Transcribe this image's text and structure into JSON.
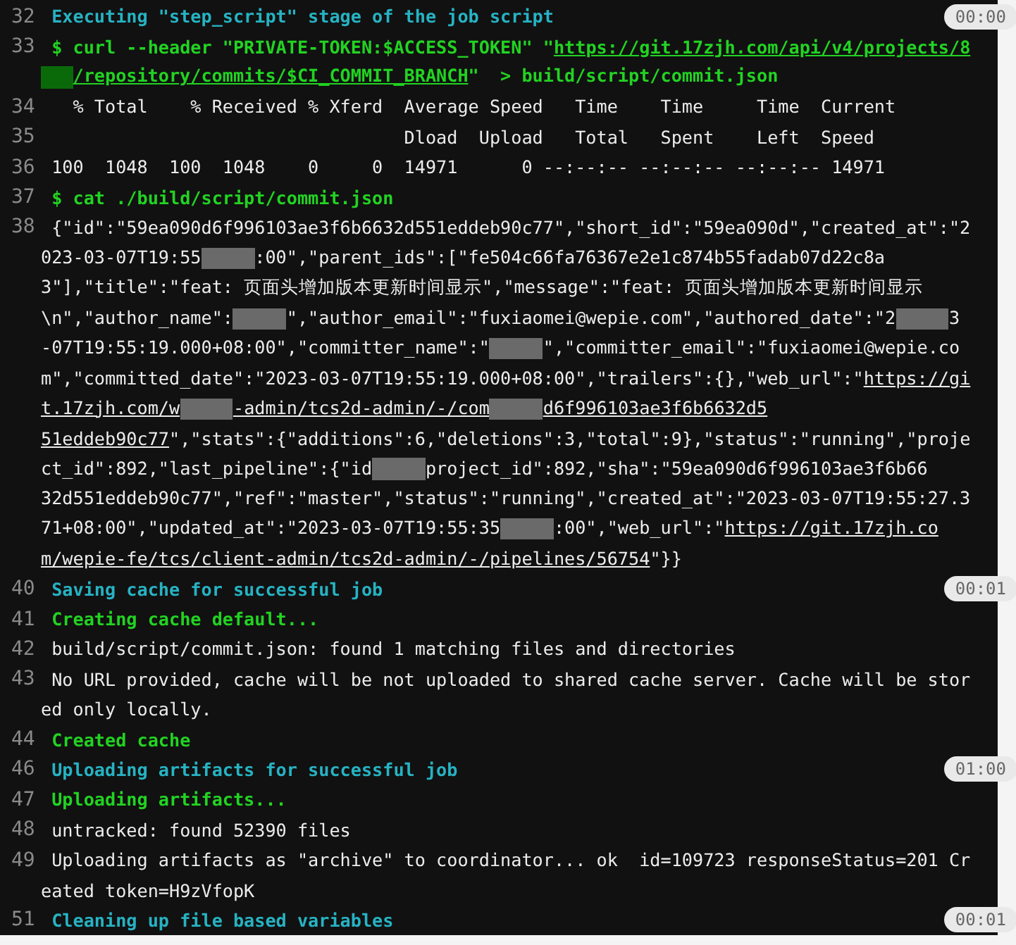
{
  "log": {
    "lines": [
      {
        "number": "32",
        "kind": "section",
        "segments": [
          {
            "kind": "text",
            "text": " Executing \"step_script\" stage of the job script"
          }
        ],
        "time": "00:00"
      },
      {
        "number": "33",
        "kind": "command",
        "segments": [
          {
            "kind": "text",
            "text": " $ curl --header \"PRIVATE-TOKEN:$ACCESS_TOKEN\" \""
          },
          {
            "kind": "link",
            "text": "https://git.17zjh.com/api/v4/projects/8"
          }
        ]
      },
      {
        "kind": "command",
        "segments": [
          {
            "kind": "redacted"
          },
          {
            "kind": "link",
            "text": "/repository/commits/$CI_COMMIT_BRANCH"
          },
          {
            "kind": "text",
            "text": "\"  > build/script/commit.json"
          }
        ]
      },
      {
        "number": "34",
        "kind": "plain",
        "segments": [
          {
            "kind": "text",
            "text": "   % Total    % Received % Xferd  Average Speed   Time    Time     Time  Current"
          }
        ]
      },
      {
        "number": "35",
        "kind": "plain",
        "segments": [
          {
            "kind": "text",
            "text": "                                  Dload  Upload   Total   Spent    Left  Speed"
          }
        ]
      },
      {
        "number": "36",
        "kind": "plain",
        "segments": [
          {
            "kind": "text",
            "text": " 100  1048  100  1048    0     0  14971      0 --:--:-- --:--:-- --:--:-- 14971"
          }
        ]
      },
      {
        "number": "37",
        "kind": "command",
        "segments": [
          {
            "kind": "text",
            "text": " $ cat ./build/script/commit.json"
          }
        ]
      },
      {
        "number": "38",
        "kind": "plain",
        "segments": [
          {
            "kind": "text",
            "text": " {\"id\":\"59ea090d6f996103ae3f6b6632d551eddeb90c77\",\"short_id\":\"59ea090d\",\"created_at\":\"2"
          }
        ]
      },
      {
        "kind": "plain",
        "segments": [
          {
            "kind": "text",
            "text": "023-03-07T19:55"
          },
          {
            "kind": "redacted"
          },
          {
            "kind": "text",
            "text": ":00\",\"parent_ids\":[\"fe504c66fa76367e2e1c874b55fadab07d22c8a"
          }
        ]
      },
      {
        "kind": "plain",
        "segments": [
          {
            "kind": "text",
            "text": "3\"],\"title\":\"feat: 页面头增加版本更新时间显示\",\"message\":\"feat: 页面头增加版本更新时间显示"
          }
        ]
      },
      {
        "kind": "plain",
        "segments": [
          {
            "kind": "text",
            "text": "\\n\",\"author_name\":"
          },
          {
            "kind": "redacted"
          },
          {
            "kind": "text",
            "text": "\",\"author_email\":\"fuxiaomei@wepie.com\",\"authored_date\":\"2"
          },
          {
            "kind": "redacted"
          },
          {
            "kind": "text",
            "text": "3"
          }
        ]
      },
      {
        "kind": "plain",
        "segments": [
          {
            "kind": "text",
            "text": "-07T19:55:19.000+08:00\",\"committer_name\":\""
          },
          {
            "kind": "redacted"
          },
          {
            "kind": "text",
            "text": "\",\"committer_email\":\"fuxiaomei@wepie.co"
          }
        ]
      },
      {
        "kind": "plain",
        "segments": [
          {
            "kind": "text",
            "text": "m\",\"committed_date\":\"2023-03-07T19:55:19.000+08:00\",\"trailers\":{},\"web_url\":\""
          },
          {
            "kind": "link",
            "text": "https://gi"
          }
        ]
      },
      {
        "kind": "plain",
        "segments": [
          {
            "kind": "link",
            "text": "t.17zjh.com/w"
          },
          {
            "kind": "redacted"
          },
          {
            "kind": "link",
            "text": "-admin/tcs2d-admin/-/com"
          },
          {
            "kind": "redacted"
          },
          {
            "kind": "link",
            "text": "d6f996103ae3f6b6632d5"
          }
        ]
      },
      {
        "kind": "plain",
        "segments": [
          {
            "kind": "link",
            "text": "51eddeb90c77"
          },
          {
            "kind": "text",
            "text": "\",\"stats\":{\"additions\":6,\"deletions\":3,\"total\":9},\"status\":\"running\",\"proje"
          }
        ]
      },
      {
        "kind": "plain",
        "segments": [
          {
            "kind": "text",
            "text": "ct_id\":892,\"last_pipeline\":{\"id"
          },
          {
            "kind": "redacted"
          },
          {
            "kind": "text",
            "text": "project_id\":892,\"sha\":\"59ea090d6f996103ae3f6b66"
          }
        ]
      },
      {
        "kind": "plain",
        "segments": [
          {
            "kind": "text",
            "text": "32d551eddeb90c77\",\"ref\":\"master\",\"status\":\"running\",\"created_at\":\"2023-03-07T19:55:27.3"
          }
        ]
      },
      {
        "kind": "plain",
        "segments": [
          {
            "kind": "text",
            "text": "71+08:00\",\"updated_at\":\"2023-03-07T19:55:35"
          },
          {
            "kind": "redacted"
          },
          {
            "kind": "text",
            "text": ":00\",\"web_url\":\""
          },
          {
            "kind": "link",
            "text": "https://git.17zjh.co"
          }
        ]
      },
      {
        "kind": "plain",
        "segments": [
          {
            "kind": "link",
            "text": "m/wepie-fe/tcs/client-admin/tcs2d-admin/-/pipelines/56754"
          },
          {
            "kind": "text",
            "text": "\"}}"
          }
        ]
      },
      {
        "number": "40",
        "kind": "section",
        "segments": [
          {
            "kind": "text",
            "text": " Saving cache for successful job"
          }
        ],
        "time": "00:01"
      },
      {
        "number": "41",
        "kind": "ok",
        "segments": [
          {
            "kind": "text",
            "text": " Creating cache default..."
          }
        ]
      },
      {
        "number": "42",
        "kind": "plain",
        "segments": [
          {
            "kind": "text",
            "text": " build/script/commit.json: found 1 matching files and directories"
          }
        ]
      },
      {
        "number": "43",
        "kind": "plain",
        "segments": [
          {
            "kind": "text",
            "text": " No URL provided, cache will be not uploaded to shared cache server. Cache will be stor"
          }
        ]
      },
      {
        "kind": "plain",
        "segments": [
          {
            "kind": "text",
            "text": "ed only locally."
          }
        ]
      },
      {
        "number": "44",
        "kind": "ok",
        "segments": [
          {
            "kind": "text",
            "text": " Created cache"
          }
        ]
      },
      {
        "number": "46",
        "kind": "section",
        "segments": [
          {
            "kind": "text",
            "text": " Uploading artifacts for successful job"
          }
        ],
        "time": "01:00"
      },
      {
        "number": "47",
        "kind": "ok",
        "segments": [
          {
            "kind": "text",
            "text": " Uploading artifacts..."
          }
        ]
      },
      {
        "number": "48",
        "kind": "plain",
        "segments": [
          {
            "kind": "text",
            "text": " untracked: found 52390 files"
          }
        ]
      },
      {
        "number": "49",
        "kind": "plain",
        "segments": [
          {
            "kind": "text",
            "text": " Uploading artifacts as \"archive\" to coordinator... ok  id=109723 responseStatus=201 Cr"
          }
        ]
      },
      {
        "kind": "plain",
        "segments": [
          {
            "kind": "text",
            "text": "eated token=H9zVfopK"
          }
        ]
      },
      {
        "number": "51",
        "kind": "section",
        "segments": [
          {
            "kind": "text",
            "text": " Cleaning up file based variables"
          }
        ],
        "time": "00:01"
      }
    ]
  }
}
